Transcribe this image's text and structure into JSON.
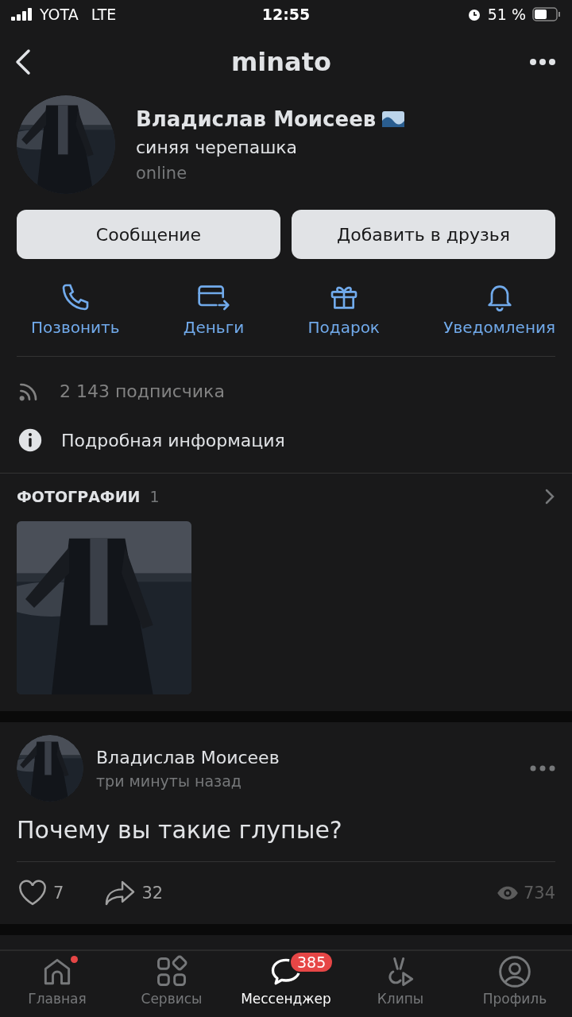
{
  "status_bar": {
    "carrier": "YOTA",
    "network": "LTE",
    "time": "12:55",
    "battery": "51 %"
  },
  "header": {
    "title": "minato"
  },
  "profile": {
    "name": "Владислав Моисеев",
    "status": "синяя черепашка",
    "presence": "online"
  },
  "buttons": [
    "Сообщение",
    "Добавить в друзья"
  ],
  "actions": [
    {
      "kind": "call",
      "label": "Позвонить"
    },
    {
      "kind": "money",
      "label": "Деньги"
    },
    {
      "kind": "gift",
      "label": "Подарок"
    },
    {
      "kind": "bell",
      "label": "Уведомления"
    }
  ],
  "info_rows": [
    {
      "kind": "followers",
      "text": "2 143 подписчика"
    },
    {
      "kind": "info",
      "text": "Подробная информация"
    }
  ],
  "photos": {
    "title": "ФОТОГРАФИИ",
    "count": "1"
  },
  "post": {
    "author": "Владислав Моисеев",
    "time": "три минуты назад",
    "text": "Почему вы такие глупые?",
    "likes": "7",
    "shares": "32",
    "views": "734"
  },
  "tabs": [
    {
      "kind": "home",
      "label": "Главная",
      "selected": false,
      "dot": true
    },
    {
      "kind": "services",
      "label": "Сервисы",
      "selected": false,
      "dot": false
    },
    {
      "kind": "messenger",
      "label": "Мессенджер",
      "selected": true,
      "dot": false,
      "badge": "385"
    },
    {
      "kind": "clips",
      "label": "Клипы",
      "selected": false,
      "dot": false
    },
    {
      "kind": "profile",
      "label": "Профиль",
      "selected": false,
      "dot": false
    }
  ]
}
